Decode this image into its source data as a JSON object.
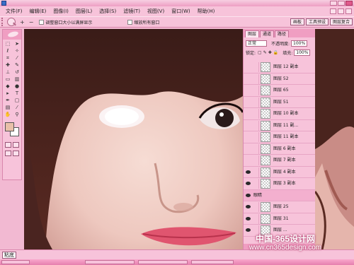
{
  "menu": [
    "文件(F)",
    "编辑(E)",
    "图像(I)",
    "图层(L)",
    "选择(S)",
    "滤镜(T)",
    "视图(V)",
    "窗口(W)",
    "帮助(H)"
  ],
  "options": {
    "zoom_in": "+",
    "zoom_out": "−",
    "fit_label": "调整窗口大小以满屏显示",
    "zoom_all_label": "缩放所有窗口",
    "right_buttons": [
      "画板",
      "工具预设",
      "图层复合"
    ]
  },
  "layers_panel": {
    "tabs": [
      "图层",
      "通道",
      "路径"
    ],
    "blend_mode": "正常",
    "opacity_label": "不透明度:",
    "opacity_value": "100%",
    "lock_label": "锁定:",
    "fill_label": "填充:",
    "fill_value": "100%",
    "layers": [
      {
        "name": "图层 12 副本",
        "visible": false
      },
      {
        "name": "图层 52",
        "visible": false
      },
      {
        "name": "图层 65",
        "visible": false
      },
      {
        "name": "图层 51",
        "visible": false
      },
      {
        "name": "图层 10 副本",
        "visible": false
      },
      {
        "name": "图层 11 副...",
        "visible": false
      },
      {
        "name": "图层 11 副本",
        "visible": false
      },
      {
        "name": "图层 6 副本",
        "visible": false
      },
      {
        "name": "图层 7 副本",
        "visible": false
      },
      {
        "name": "图层 4 副本",
        "visible": true
      },
      {
        "name": "图层 3 副本",
        "visible": true
      },
      {
        "name": "眼睛",
        "visible": true,
        "group": true
      },
      {
        "name": "图层 25",
        "visible": true
      },
      {
        "name": "图层 31",
        "visible": true
      },
      {
        "name": "图层 ...",
        "visible": true
      }
    ]
  },
  "statusbar": {
    "zoom": "粘底"
  },
  "watermark": {
    "line1": "中国-365设计网",
    "line2": "www.cn365design.com"
  },
  "colors": {
    "accent": "#f7c3da",
    "foreground": "#e9c0a9",
    "background": "#ffffff"
  }
}
